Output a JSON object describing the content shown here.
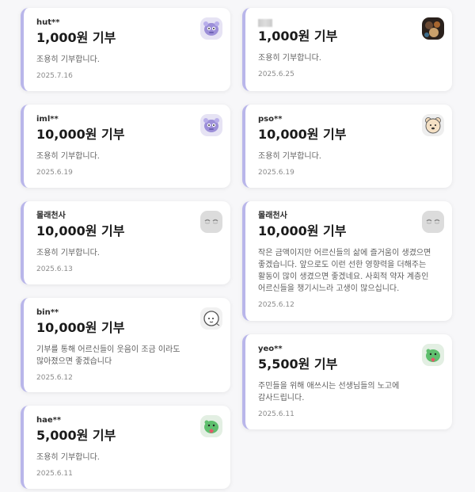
{
  "donations_left": [
    {
      "nickname": "hut**",
      "amount": "1,000원 기부",
      "message": "조용히 기부합니다.",
      "date": "2025.7.16",
      "avatar_icon": "purple-monster-avatar-icon"
    },
    {
      "nickname": "iml**",
      "amount": "10,000원 기부",
      "message": "조용히 기부합니다.",
      "date": "2025.6.19",
      "avatar_icon": "purple-monster-avatar-icon"
    },
    {
      "nickname": "몰래천사",
      "amount": "10,000원 기부",
      "message": "조용히 기부합니다.",
      "date": "2025.6.13",
      "avatar_icon": "closed-eyes-avatar-icon"
    },
    {
      "nickname": "bin**",
      "amount": "10,000원 기부",
      "message": "기부를 통해 어르신들이 웃음이 조금 이라도 많아졌으면 좋겠습니다",
      "date": "2025.6.12",
      "avatar_icon": "doodle-face-avatar-icon"
    },
    {
      "nickname": "hae**",
      "amount": "5,000원 기부",
      "message": "조용히 기부합니다.",
      "date": "2025.6.11",
      "avatar_icon": "green-dino-avatar-icon"
    }
  ],
  "donations_right": [
    {
      "nickname": "",
      "nickname_hidden": true,
      "amount": "1,000원 기부",
      "message": "조용히 기부합니다.",
      "date": "2025.6.25",
      "avatar_icon": "photo-avatar-icon"
    },
    {
      "nickname": "pso**",
      "amount": "10,000원 기부",
      "message": "조용히 기부합니다.",
      "date": "2025.6.19",
      "avatar_icon": "bear-face-avatar-icon"
    },
    {
      "nickname": "몰래천사",
      "amount": "10,000원 기부",
      "message": "작은 금액이지만 어르신들의 삶에 즐거움이 생겼으면 좋겠습니다. 앞으로도 이런 선한 영향력을 더해주는 활동이 많이 생겼으면 좋겠네요. 사회적 약자 계층인 어르신들을 챙기시느라 고생이 많으십니다.",
      "date": "2025.6.12",
      "avatar_icon": "closed-eyes-avatar-icon"
    },
    {
      "nickname": "yeo**",
      "amount": "5,500원 기부",
      "message": "주민들을 위해 애쓰시는 선생님들의 노고에 감사드립니다.",
      "date": "2025.6.11",
      "avatar_icon": "green-dino-avatar-icon"
    }
  ],
  "colors": {
    "accent_bar": "#b9b6ea",
    "card_bg": "#ffffff",
    "page_bg": "#f7f7f9"
  }
}
